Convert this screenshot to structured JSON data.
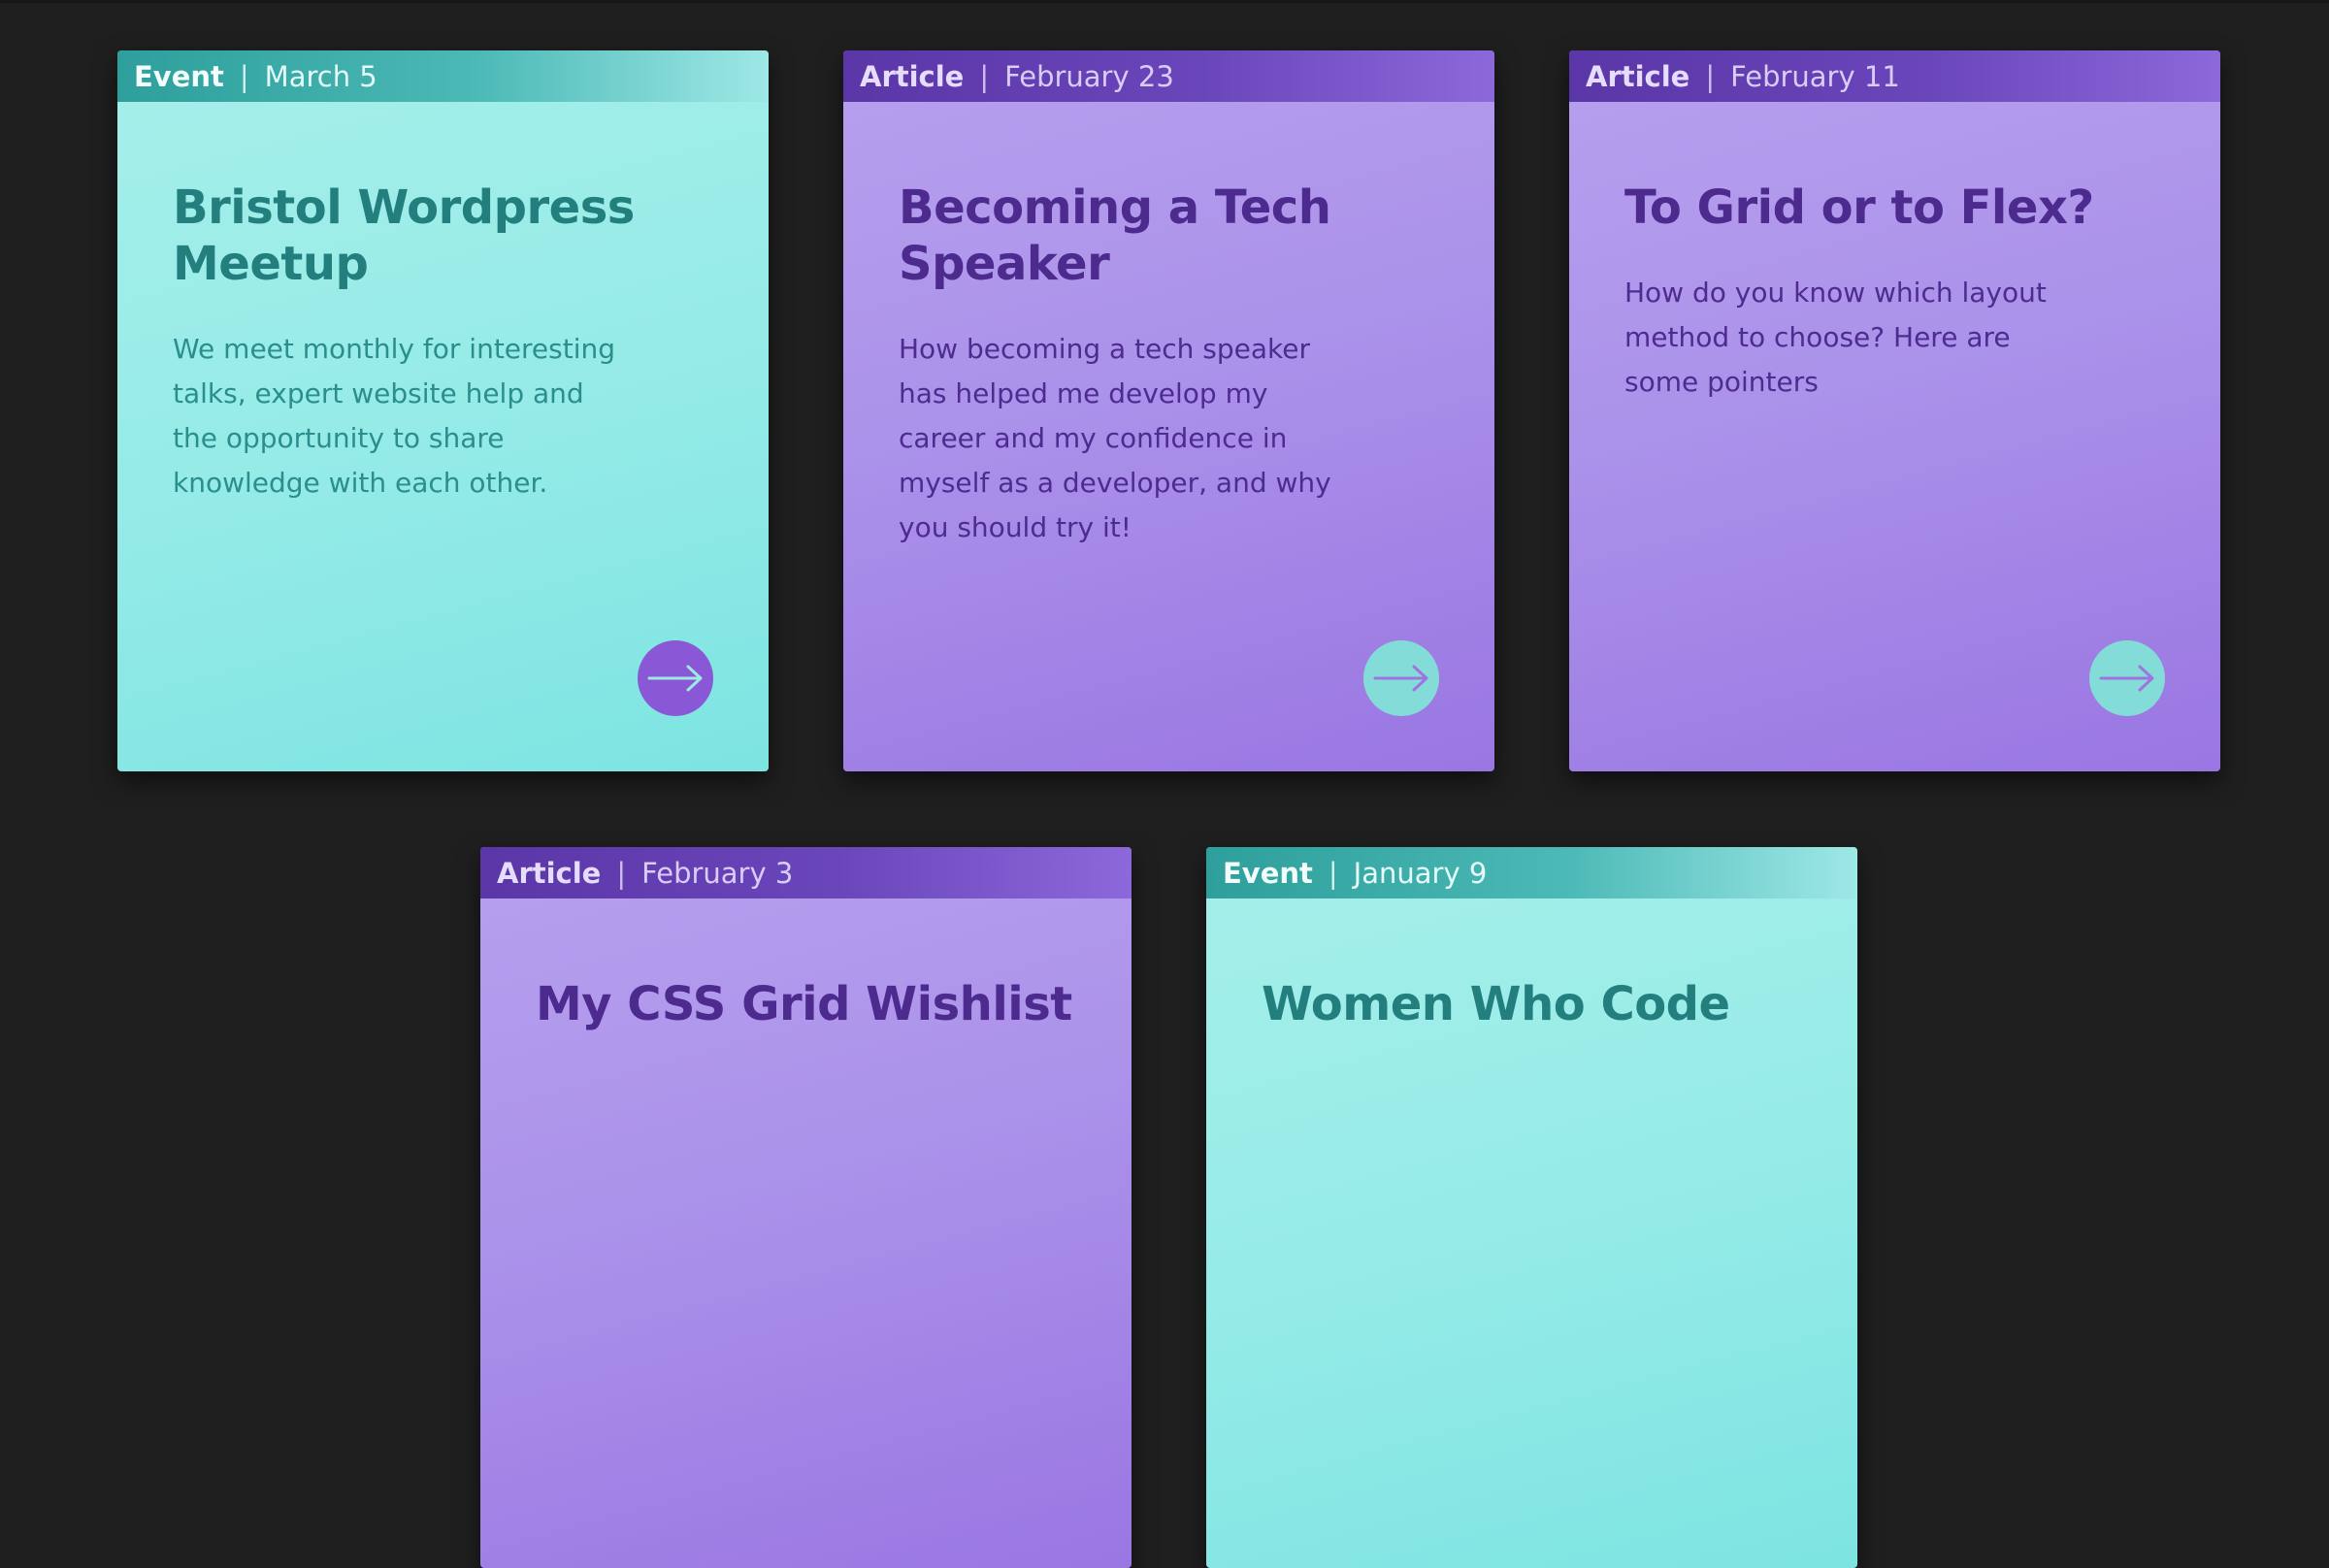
{
  "cards": [
    {
      "type_label": "Event",
      "separator": "|",
      "date": "March 5",
      "title": "Bristol Wordpress Meetup",
      "text": "We meet monthly for interesting talks, expert website help and the opportunity to share knowledge with each other."
    },
    {
      "type_label": "Article",
      "separator": "|",
      "date": "February 23",
      "title": "Becoming a Tech Speaker",
      "text": "How becoming a tech speaker has helped me develop my career and my confidence in myself as a developer, and why you should try it!"
    },
    {
      "type_label": "Article",
      "separator": "|",
      "date": "February 11",
      "title": "To Grid or to Flex?",
      "text": "How do you know which layout method to choose? Here are some pointers"
    },
    {
      "type_label": "Article",
      "separator": "|",
      "date": "February 3",
      "title": "My CSS Grid Wishlist",
      "text": ""
    },
    {
      "type_label": "Event",
      "separator": "|",
      "date": "January 9",
      "title": "Women Who Code",
      "text": ""
    }
  ],
  "icons": {
    "arrow": "arrow-right-icon"
  },
  "colors": {
    "page_background": "#1f1f1f",
    "event_card": "#9aece8",
    "event_header": "#3aaca9",
    "event_title": "#237f7e",
    "article_card": "#ab92ea",
    "article_header": "#5f3cb0",
    "article_title": "#4c2a8e",
    "event_arrow_button": "#8a58d6",
    "article_arrow_button": "#84dcd8"
  }
}
